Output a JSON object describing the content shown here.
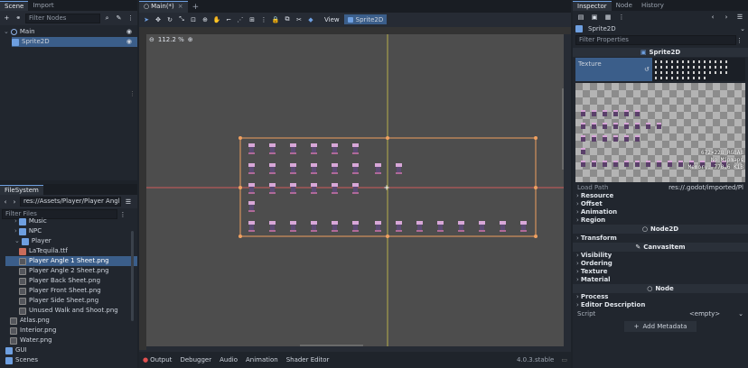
{
  "scene_dock": {
    "tabs": [
      "Scene",
      "Import"
    ],
    "filter_placeholder": "Filter Nodes",
    "tree": [
      {
        "label": "Main",
        "icon": "node2d-icon"
      },
      {
        "label": "Sprite2D",
        "icon": "sprite2d-icon"
      }
    ]
  },
  "filesystem_dock": {
    "tab": "FileSystem",
    "path": "res://Assets/Player/Player Angle 1 She",
    "filter_placeholder": "Filter Files",
    "items": [
      {
        "label": "Music",
        "type": "folder"
      },
      {
        "label": "NPC",
        "type": "folder"
      },
      {
        "label": "Player",
        "type": "folder"
      },
      {
        "label": "LaTequila.ttf",
        "type": "font"
      },
      {
        "label": "Player Angle 1 Sheet.png",
        "type": "image",
        "selected": true
      },
      {
        "label": "Player Angle 2 Sheet.png",
        "type": "image"
      },
      {
        "label": "Player Back Sheet.png",
        "type": "image"
      },
      {
        "label": "Player Front Sheet.png",
        "type": "image"
      },
      {
        "label": "Player Side Sheet.png",
        "type": "image"
      },
      {
        "label": "Unused Walk and Shoot.png",
        "type": "image"
      },
      {
        "label": "Atlas.png",
        "type": "image"
      },
      {
        "label": "Interior.png",
        "type": "image"
      },
      {
        "label": "Water.png",
        "type": "image"
      },
      {
        "label": "GUI",
        "type": "folder"
      },
      {
        "label": "Scenes",
        "type": "folder"
      }
    ]
  },
  "editor": {
    "scene_tab": "Main(*)",
    "add_tab": "+",
    "view_menu": "View",
    "breadcrumb": "Sprite2D",
    "zoom": "112.2 %"
  },
  "bottom_bar": {
    "tabs": [
      "Output",
      "Debugger",
      "Audio",
      "Animation",
      "Shader Editor"
    ],
    "version": "4.0.3.stable"
  },
  "inspector": {
    "tabs": [
      "Inspector",
      "Node",
      "History"
    ],
    "object_name": "Sprite2D",
    "filter_placeholder": "Filter Properties",
    "class_header": "Sprite2D",
    "texture_label": "Texture",
    "texture_info": [
      "672×228 RGBA8",
      "No Mipmaps",
      "Memory: 770.6 KiB"
    ],
    "load_path_label": "Load Path",
    "load_path_value": "res://.godot/imported/Pl",
    "sprite_sections": [
      "Resource",
      "Offset",
      "Animation",
      "Region"
    ],
    "node2d_header": "Node2D",
    "node2d_sections": [
      "Transform"
    ],
    "canvasitem_header": "CanvasItem",
    "canvasitem_sections": [
      "Visibility",
      "Ordering",
      "Texture",
      "Material"
    ],
    "node_header": "Node",
    "node_sections": [
      "Process",
      "Editor Description"
    ],
    "script_label": "Script",
    "script_value": "<empty>",
    "add_metadata": "Add Metadata"
  },
  "colors": {
    "accent": "#6e9fe0",
    "selection": "#3b5e8a",
    "viewport_bg": "#4d4d4d",
    "sprite_frame": "#f0a060",
    "axis_x": "#d05a5a",
    "axis_y": "#b8b04a"
  }
}
